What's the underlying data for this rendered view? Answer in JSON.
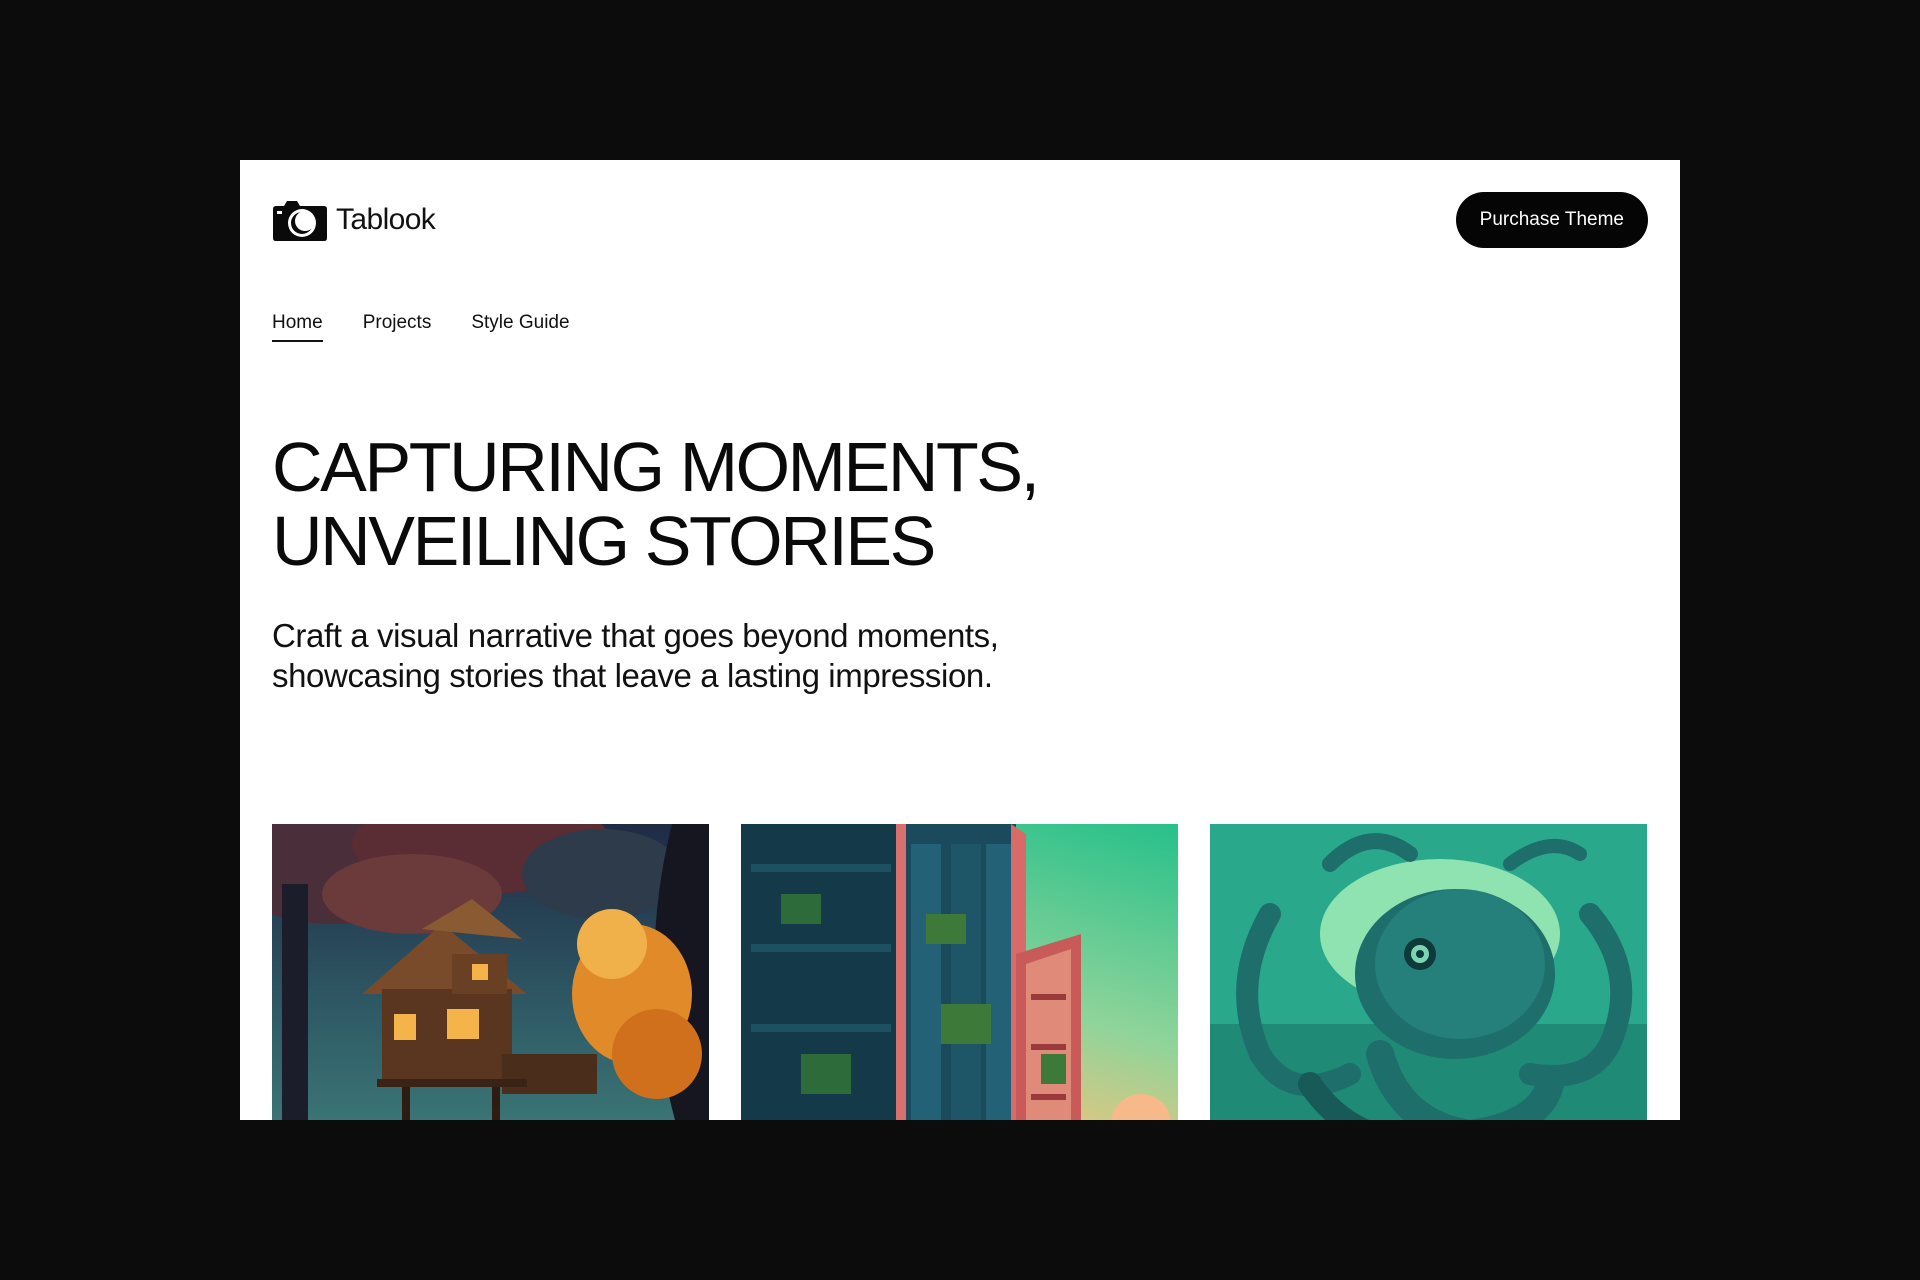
{
  "header": {
    "brand_name": "Tablook",
    "logo_icon": "camera-icon",
    "cta_label": "Purchase Theme"
  },
  "nav": {
    "items": [
      {
        "label": "Home",
        "active": true
      },
      {
        "label": "Projects",
        "active": false
      },
      {
        "label": "Style Guide",
        "active": false
      }
    ]
  },
  "hero": {
    "title_lines": [
      "CAPTURING MOMENTS,",
      "UNVEILING STORIES"
    ],
    "subtitle_lines": [
      "Craft a visual narrative that goes beyond moments,",
      "showcasing stories that leave a lasting impression."
    ]
  },
  "gallery": {
    "items": [
      {
        "name": "treehouse-illustration"
      },
      {
        "name": "building-illustration"
      },
      {
        "name": "octopus-illustration"
      }
    ]
  },
  "colors": {
    "page_background": "#0c0c0c",
    "frame_background": "#ffffff",
    "cta_background": "#050505",
    "text": "#111111"
  }
}
